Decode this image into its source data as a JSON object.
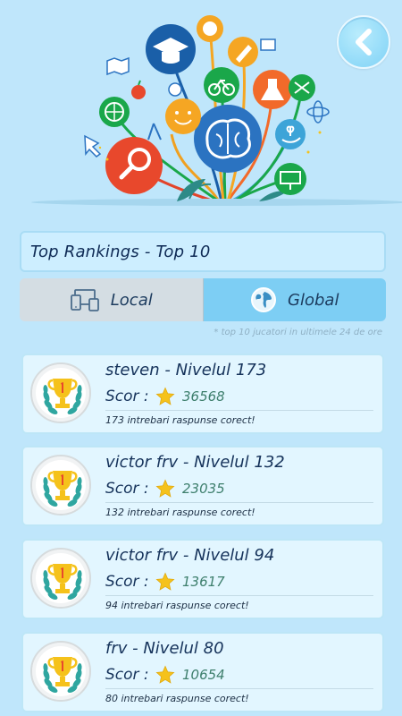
{
  "header": {
    "back_icon": "chevron-left-icon"
  },
  "title": "Top Rankings - Top 10",
  "tabs": [
    {
      "label": "Local",
      "icon": "devices-icon",
      "selected": false
    },
    {
      "label": "Global",
      "icon": "globe-icon",
      "selected": true
    }
  ],
  "note": "* top 10 jucatori in ultimele 24 de ore",
  "score_label": "Scor :",
  "rankings": [
    {
      "name": "steven - Nivelul 173",
      "score": "36568",
      "answers": "173 intrebari raspunse corect!"
    },
    {
      "name": "victor frv - Nivelul 132",
      "score": "23035",
      "answers": "132 intrebari raspunse corect!"
    },
    {
      "name": "victor frv - Nivelul 94",
      "score": "13617",
      "answers": "94 intrebari raspunse corect!"
    },
    {
      "name": "frv - Nivelul 80",
      "score": "10654",
      "answers": "80 intrebari raspunse corect!"
    }
  ],
  "colors": {
    "background": "#bfe6fb",
    "tab_selected": "#7dcef4",
    "tab_unselected": "#d4dde3",
    "card": "#e2f6ff",
    "score": "#3e7f6d",
    "star": "#f5c21b"
  }
}
